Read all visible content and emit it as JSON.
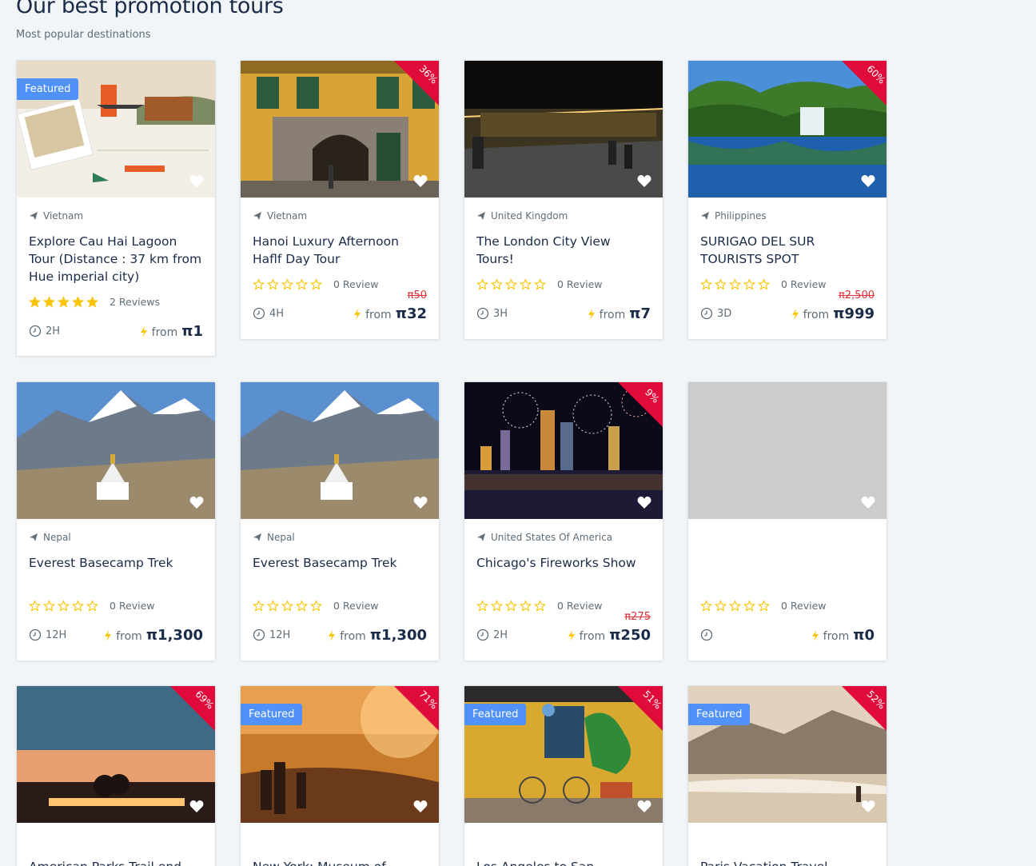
{
  "header": {
    "title": "Our best promotion tours",
    "subtitle": "Most popular destinations"
  },
  "colors": {
    "accent": "#5191fa",
    "sale": "#e00b3a",
    "star": "#fac50a"
  },
  "badge_label": "Featured",
  "from_label": "from",
  "cards": [
    {
      "location": "Vietnam",
      "title": "Explore Cau Hai Lagoon Tour (Distance : 37 km from Hue imperial city)",
      "rating": 5,
      "reviews": "2 Reviews",
      "duration": "2H",
      "price": "π1",
      "old_price": "",
      "discount": "",
      "featured": true,
      "image": "poster"
    },
    {
      "location": "Vietnam",
      "title": "Hanoi Luxury Afternoon Haflf Day Tour",
      "rating": 0,
      "reviews": "0 Review",
      "duration": "4H",
      "price": "π32",
      "old_price": "π50",
      "discount": "36%",
      "featured": false,
      "image": "building"
    },
    {
      "location": "United Kingdom",
      "title": "The London City View Tours!",
      "rating": 0,
      "reviews": "0 Review",
      "duration": "3H",
      "price": "π7",
      "old_price": "",
      "discount": "",
      "featured": false,
      "image": "night-street"
    },
    {
      "location": "Philippines",
      "title": "SURIGAO DEL SUR TOURISTS SPOT",
      "rating": 0,
      "reviews": "0 Review",
      "duration": "3D",
      "price": "π999",
      "old_price": "π2,500",
      "discount": "60%",
      "featured": false,
      "image": "lake"
    },
    {
      "location": "Nepal",
      "title": "Everest Basecamp Trek",
      "rating": 0,
      "reviews": "0 Review",
      "duration": "12H",
      "price": "π1,300",
      "old_price": "",
      "discount": "",
      "featured": false,
      "image": "mountain"
    },
    {
      "location": "Nepal",
      "title": "Everest Basecamp Trek",
      "rating": 0,
      "reviews": "0 Review",
      "duration": "12H",
      "price": "π1,300",
      "old_price": "",
      "discount": "",
      "featured": false,
      "image": "mountain"
    },
    {
      "location": "United States Of America",
      "title": "Chicago's Fireworks Show",
      "rating": 0,
      "reviews": "0 Review",
      "duration": "2H",
      "price": "π250",
      "old_price": "π275",
      "discount": "9%",
      "featured": false,
      "image": "fireworks"
    },
    {
      "location": "",
      "title": "",
      "rating": 0,
      "reviews": "0 Review",
      "duration": "",
      "price": "π0",
      "old_price": "",
      "discount": "",
      "featured": false,
      "image": "blank"
    },
    {
      "location": "",
      "title": "American Parks Trail end Rapid City",
      "rating": 0,
      "reviews": "",
      "duration": "",
      "price": "",
      "old_price": "",
      "discount": "69%",
      "featured": false,
      "image": "sunset"
    },
    {
      "location": "",
      "title": "New York: Museum of Modern Art",
      "rating": 0,
      "reviews": "",
      "duration": "",
      "price": "",
      "old_price": "",
      "discount": "71%",
      "featured": true,
      "image": "golden"
    },
    {
      "location": "",
      "title": "Los Angeles to San Francisco Express",
      "rating": 0,
      "reviews": "",
      "duration": "",
      "price": "",
      "old_price": "",
      "discount": "51%",
      "featured": true,
      "image": "yellow-wall"
    },
    {
      "location": "",
      "title": "Paris Vacation Travel",
      "rating": 0,
      "reviews": "",
      "duration": "",
      "price": "",
      "old_price": "",
      "discount": "52%",
      "featured": true,
      "image": "beach"
    }
  ]
}
